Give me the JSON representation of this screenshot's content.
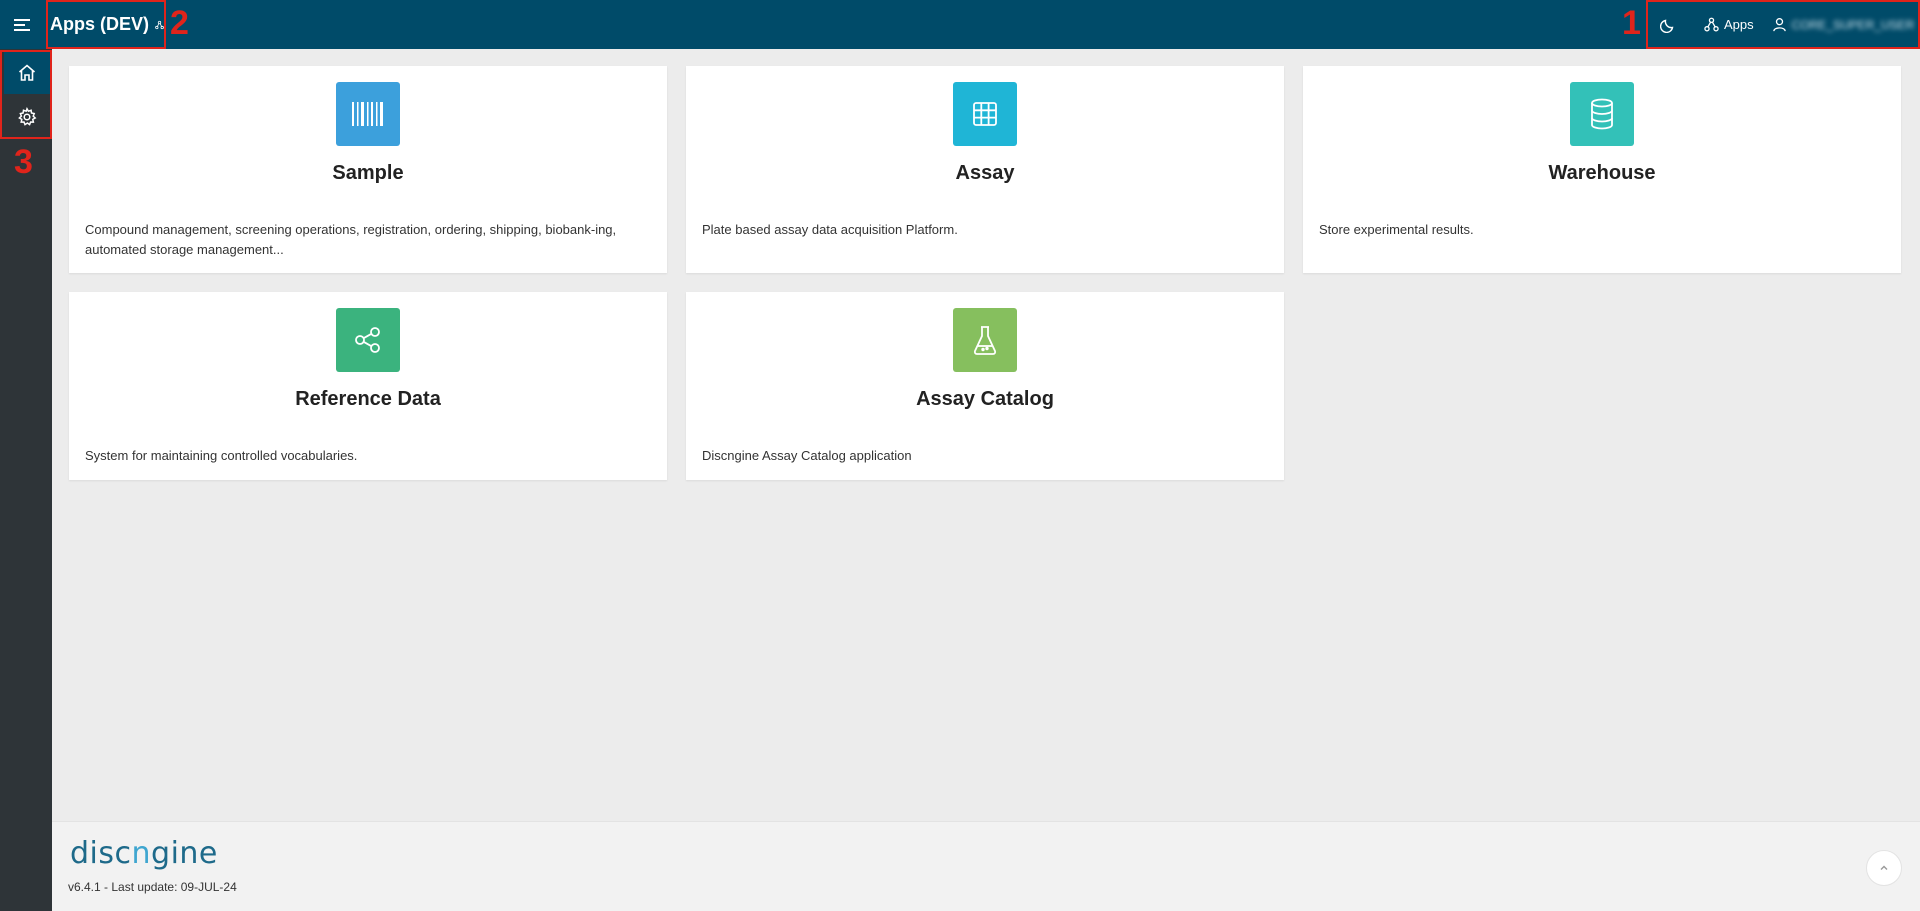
{
  "header": {
    "title": "Apps (DEV)",
    "apps_label": "Apps",
    "user_name": "CORE_SUPER_USER",
    "bg_color": "#004b69"
  },
  "annotations": [
    "1",
    "2",
    "3"
  ],
  "sidebar": {
    "items": [
      {
        "icon": "home-icon"
      },
      {
        "icon": "gear-icon"
      }
    ]
  },
  "cards": [
    {
      "title": "Sample",
      "description": "Compound management, screening operations, registration, ordering, shipping, biobank-ing, automated storage management...",
      "color": "#3ca0dc",
      "icon": "barcode-icon"
    },
    {
      "title": "Assay",
      "description": "Plate based assay data acquisition Platform.",
      "color": "#1fb5d6",
      "icon": "grid-icon"
    },
    {
      "title": "Warehouse",
      "description": "Store experimental results.",
      "color": "#33c1b8",
      "icon": "database-icon"
    },
    {
      "title": "Reference Data",
      "description": "System for maintaining controlled vocabularies.",
      "color": "#3bb37e",
      "icon": "share-nodes-icon"
    },
    {
      "title": "Assay Catalog",
      "description": "Discngine Assay Catalog application",
      "color": "#86bf5e",
      "icon": "flask-icon"
    }
  ],
  "footer": {
    "logo_part1": "disc",
    "logo_part2": "n",
    "logo_part3": "gine",
    "version": "v6.4.1 - Last update: 09-JUL-24"
  }
}
